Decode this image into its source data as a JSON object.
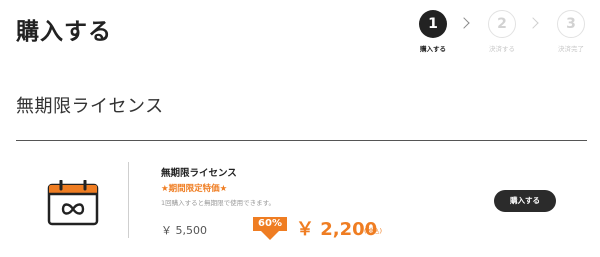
{
  "header": {
    "title": "購入する",
    "steps": [
      {
        "number": "1",
        "label": "購入する",
        "state": "active"
      },
      {
        "number": "2",
        "label": "決済する",
        "state": "inactive"
      },
      {
        "number": "3",
        "label": "決済完了",
        "state": "inactive"
      }
    ]
  },
  "section": {
    "title": "無期限ライセンス"
  },
  "product": {
    "icon": "calendar-infinity-icon",
    "name": "無期限ライセンス",
    "promo": "★期間限定特価★",
    "description": "1回購入すると無期限で使用できます。",
    "original_price": "￥ 5,500",
    "discount": "60%",
    "sale_price": "￥ 2,200",
    "tax_note": "(税込)",
    "buy_label": "購入する"
  },
  "colors": {
    "accent": "#ef7d22",
    "dark": "#2b2b2b"
  }
}
